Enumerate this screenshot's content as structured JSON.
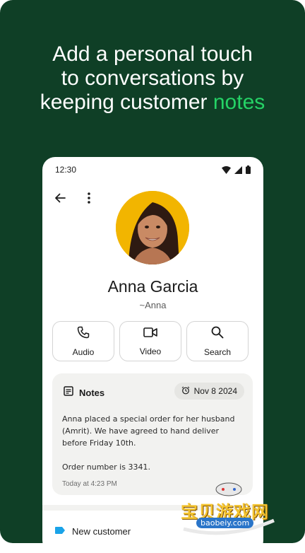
{
  "headline": {
    "line1": "Add a personal touch",
    "line2": "to conversations by",
    "line3_prefix": "keeping customer ",
    "line3_accent": "notes"
  },
  "colors": {
    "background": "#0f3f26",
    "accent": "#25d366",
    "avatar_bg": "#f2b500",
    "label_tag": "#1aa3e8"
  },
  "statusbar": {
    "time": "12:30",
    "icons": [
      "wifi-icon",
      "signal-icon",
      "battery-icon"
    ]
  },
  "topbar": {
    "back_icon": "back-arrow-icon",
    "menu_icon": "more-vertical-icon"
  },
  "contact": {
    "name": "Anna Garcia",
    "pushname": "~Anna"
  },
  "actions": [
    {
      "label": "Audio",
      "icon": "phone-icon"
    },
    {
      "label": "Video",
      "icon": "video-camera-icon"
    },
    {
      "label": "Search",
      "icon": "search-icon"
    }
  ],
  "notes": {
    "title": "Notes",
    "reminder": "Nov 8 2024",
    "body_line1": "Anna placed a special order for her husband (Amrit). We have agreed to hand deliver before Friday 10th.",
    "body_line2": "Order number is 3341.",
    "timestamp": "Today at 4:23 PM"
  },
  "labels": [
    {
      "text": "New customer",
      "icon": "label-tag-icon"
    }
  ],
  "watermark": {
    "text": "宝贝游戏网",
    "url": "baobeiy.com"
  }
}
